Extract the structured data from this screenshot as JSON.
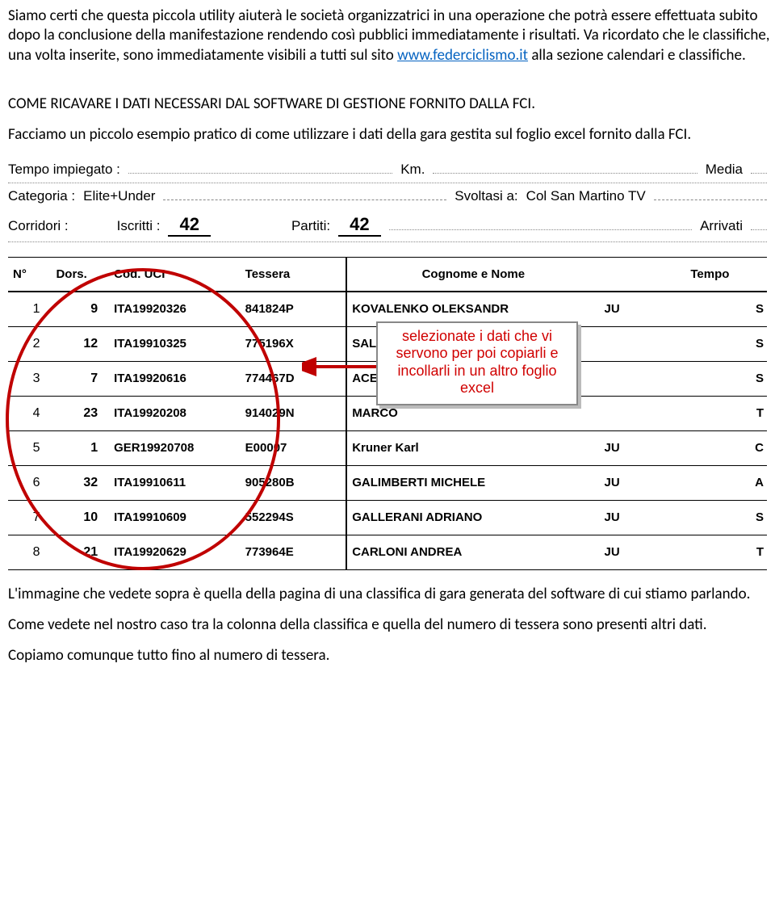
{
  "paragraphs": {
    "p1a": "Siamo certi che questa piccola utility aiuterà le società organizzatrici in una operazione che potrà essere effettuata subito dopo la conclusione della manifestazione rendendo così pubblici immediatamente i risultati.   Va ricordato che le classifiche, una volta inserite, sono immediatamente visibili a tutti sul sito ",
    "link_text": "www.federciclismo.it",
    "p1b": " alla sezione calendari e classifiche.",
    "heading": "COME RICAVARE I DATI NECESSARI DAL SOFTWARE DI GESTIONE FORNITO DALLA FCI.",
    "p2": "Facciamo un piccolo esempio pratico di come utilizzare i dati della gara gestita sul foglio excel fornito dalla FCI.",
    "p3": "L'immagine che vedete sopra è quella della pagina di una classifica di gara generata del software di cui stiamo parlando.",
    "p4": "Come vedete nel nostro caso tra la colonna della classifica e quella del numero di tessera sono presenti altri dati.",
    "p5": "Copiamo comunque tutto fino al numero di tessera."
  },
  "info": {
    "tempo_label": "Tempo impiegato :",
    "km_label": "Km.",
    "media_label": "Media",
    "cat_label": "Categoria :",
    "cat_value": "Elite+Under",
    "svoltasi_label": "Svoltasi a:",
    "svoltasi_value": "Col San Martino TV",
    "corridori_label": "Corridori :",
    "iscritti_label": "Iscritti :",
    "iscritti_value": "42",
    "partiti_label": "Partiti:",
    "partiti_value": "42",
    "arrivati_label": "Arrivati"
  },
  "table": {
    "headers": [
      "N°",
      "Dors.",
      "Cod. UCI",
      "Tessera",
      "Cognome e Nome",
      "",
      "Tempo"
    ],
    "rows": [
      {
        "n": "1",
        "dors": "9",
        "uci": "ITA19920326",
        "tess": "841824P",
        "nome": "KOVALENKO OLEKSANDR",
        "c": "JU",
        "t": "S"
      },
      {
        "n": "2",
        "dors": "12",
        "uci": "ITA19910325",
        "tess": "775196X",
        "nome": "SALATI",
        "c": "",
        "t": "S"
      },
      {
        "n": "3",
        "dors": "7",
        "uci": "ITA19920616",
        "tess": "774467D",
        "nome": "ACERBI",
        "c": "",
        "t": "S"
      },
      {
        "n": "4",
        "dors": "23",
        "uci": "ITA19920208",
        "tess": "914029N",
        "nome": "MARCO",
        "c": "",
        "t": "T"
      },
      {
        "n": "5",
        "dors": "1",
        "uci": "GER19920708",
        "tess": "E00007",
        "nome": "Kruner Karl",
        "c": "JU",
        "t": "C"
      },
      {
        "n": "6",
        "dors": "32",
        "uci": "ITA19910611",
        "tess": "905280B",
        "nome": "GALIMBERTI MICHELE",
        "c": "JU",
        "t": "A"
      },
      {
        "n": "7",
        "dors": "10",
        "uci": "ITA19910609",
        "tess": "552294S",
        "nome": "GALLERANI ADRIANO",
        "c": "JU",
        "t": "S"
      },
      {
        "n": "8",
        "dors": "21",
        "uci": "ITA19920629",
        "tess": "773964E",
        "nome": "CARLONI ANDREA",
        "c": "JU",
        "t": "T"
      }
    ]
  },
  "callout": "selezionate i dati che vi servono per poi copiarli e incollarli in un altro foglio excel"
}
